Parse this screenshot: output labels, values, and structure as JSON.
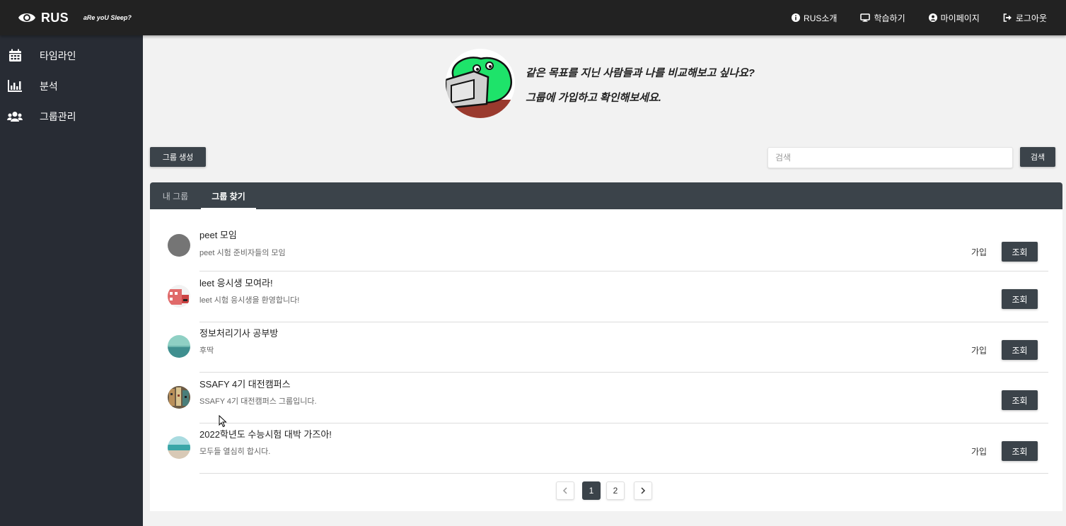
{
  "topbar": {
    "brand": "RUS",
    "tagline": "aRe yoU Sleep?",
    "nav": [
      {
        "label": "RUS소개",
        "icon": "info-icon"
      },
      {
        "label": "학습하기",
        "icon": "monitor-icon"
      },
      {
        "label": "마이페이지",
        "icon": "user-circle-icon"
      },
      {
        "label": "로그아웃",
        "icon": "logout-icon"
      }
    ]
  },
  "sidebar": {
    "items": [
      {
        "label": "타임라인",
        "icon": "calendar-icon"
      },
      {
        "label": "분석",
        "icon": "bar-chart-icon"
      },
      {
        "label": "그룹관리",
        "icon": "users-icon"
      }
    ]
  },
  "hero": {
    "line1": "같은 목표를 지닌 사람들과 나를 비교해보고 싶나요?",
    "line2": "그룹에 가입하고 확인해보세요."
  },
  "actions": {
    "create_label": "그룹 생성",
    "search_placeholder": "검색",
    "search_value": "",
    "search_label": "검색"
  },
  "tabs": [
    {
      "label": "내 그룹",
      "active": false
    },
    {
      "label": "그룹 찾기",
      "active": true
    }
  ],
  "groups": [
    {
      "title": "peet 모임",
      "desc": "peet 시험 준비자들의 모임",
      "join": "가입",
      "view": "조회"
    },
    {
      "title": "leet 응시생 모여라!",
      "desc": "leet 시험 응시생을 환영합니다!",
      "join": "",
      "view": "조회"
    },
    {
      "title": "정보처리기사 공부방",
      "desc": "후딱",
      "join": "가입",
      "view": "조회"
    },
    {
      "title": "SSAFY 4기 대전캠퍼스",
      "desc": "SSAFY 4기 대전캠퍼스 그룹입니다.",
      "join": "",
      "view": "조회"
    },
    {
      "title": "2022학년도 수능시험 대박 가즈아!",
      "desc": "모두들 열심히 합시다.",
      "join": "가입",
      "view": "조회"
    }
  ],
  "pagination": {
    "pages": [
      "1",
      "2"
    ],
    "current": "1",
    "prev_icon": "chevron-left-icon",
    "next_icon": "chevron-right-icon"
  },
  "colors": {
    "topbar": "#222222",
    "sidebar": "#282c34",
    "button": "#3b434a",
    "page_bg": "#f2f2f2"
  }
}
